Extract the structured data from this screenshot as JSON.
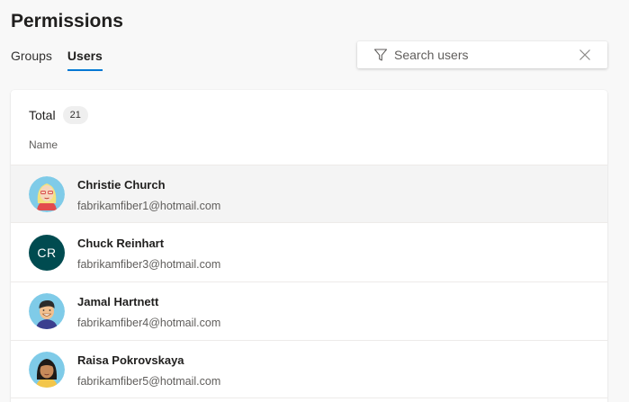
{
  "page": {
    "title": "Permissions"
  },
  "tabs": [
    {
      "label": "Groups",
      "selected": false
    },
    {
      "label": "Users",
      "selected": true
    }
  ],
  "search": {
    "placeholder": "Search users",
    "value": "",
    "filter_icon": "filter-icon",
    "clear_icon": "close-icon"
  },
  "list": {
    "total_label": "Total",
    "total_count": "21",
    "column_header": "Name",
    "users": [
      {
        "name": "Christie Church",
        "email": "fabrikamfiber1@hotmail.com",
        "avatar": "photo-blonde-woman",
        "initials": ""
      },
      {
        "name": "Chuck Reinhart",
        "email": "fabrikamfiber3@hotmail.com",
        "avatar": "initials",
        "initials": "CR"
      },
      {
        "name": "Jamal Hartnett",
        "email": "fabrikamfiber4@hotmail.com",
        "avatar": "photo-man",
        "initials": ""
      },
      {
        "name": "Raisa Pokrovskaya",
        "email": "fabrikamfiber5@hotmail.com",
        "avatar": "photo-dark-hair-woman",
        "initials": ""
      }
    ]
  },
  "colors": {
    "accent": "#0078d4",
    "initials_bg": "#004b50"
  }
}
